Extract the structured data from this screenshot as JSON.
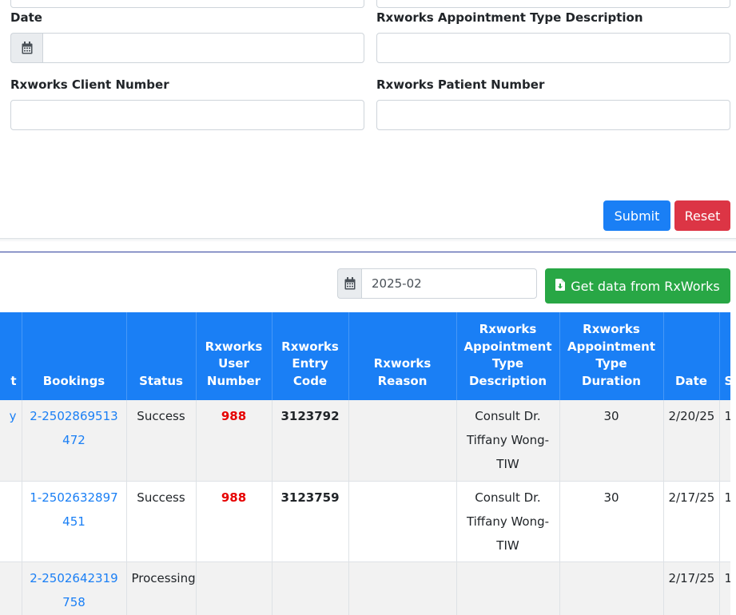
{
  "form": {
    "date_label": "Date",
    "date_value": "",
    "appt_type_desc_label": "Rxworks Appointment Type Description",
    "appt_type_desc_value": "",
    "client_number_label": "Rxworks Client Number",
    "client_number_value": "",
    "patient_number_label": "Rxworks Patient Number",
    "patient_number_value": "",
    "submit_label": "Submit",
    "reset_label": "Reset"
  },
  "toolbar": {
    "month_value": "2025-02",
    "get_data_label": "Get data from RxWorks"
  },
  "colors": {
    "primary": "#1a7ff5",
    "danger": "#dc3545",
    "success": "#28a745",
    "highlight_red": "#e60000"
  },
  "table": {
    "headers": [
      "t",
      "Bookings",
      "Status",
      "Rxworks User Number",
      "Rxworks Entry Code",
      "Rxworks Reason",
      "Rxworks Appointment Type Description",
      "Rxworks Appointment Type Duration",
      "Date",
      "S T"
    ],
    "rows": [
      {
        "prev": "y",
        "booking": "2-2502869513472",
        "status": "Success",
        "user_number": "988",
        "entry_code": "3123792",
        "reason": "",
        "appt_desc": "Consult Dr. Tiffany Wong-TIW",
        "duration": "30",
        "date": "2/20/25",
        "next": "1"
      },
      {
        "prev": "",
        "booking": "1-2502632897451",
        "status": "Success",
        "user_number": "988",
        "entry_code": "3123759",
        "reason": "",
        "appt_desc": "Consult Dr. Tiffany Wong-TIW",
        "duration": "30",
        "date": "2/17/25",
        "next": "1"
      },
      {
        "prev": "",
        "booking": "2-2502642319758",
        "status": "Processing",
        "user_number": "",
        "entry_code": "",
        "reason": "",
        "appt_desc": "",
        "duration": "",
        "date": "2/17/25",
        "next": "1"
      }
    ]
  }
}
